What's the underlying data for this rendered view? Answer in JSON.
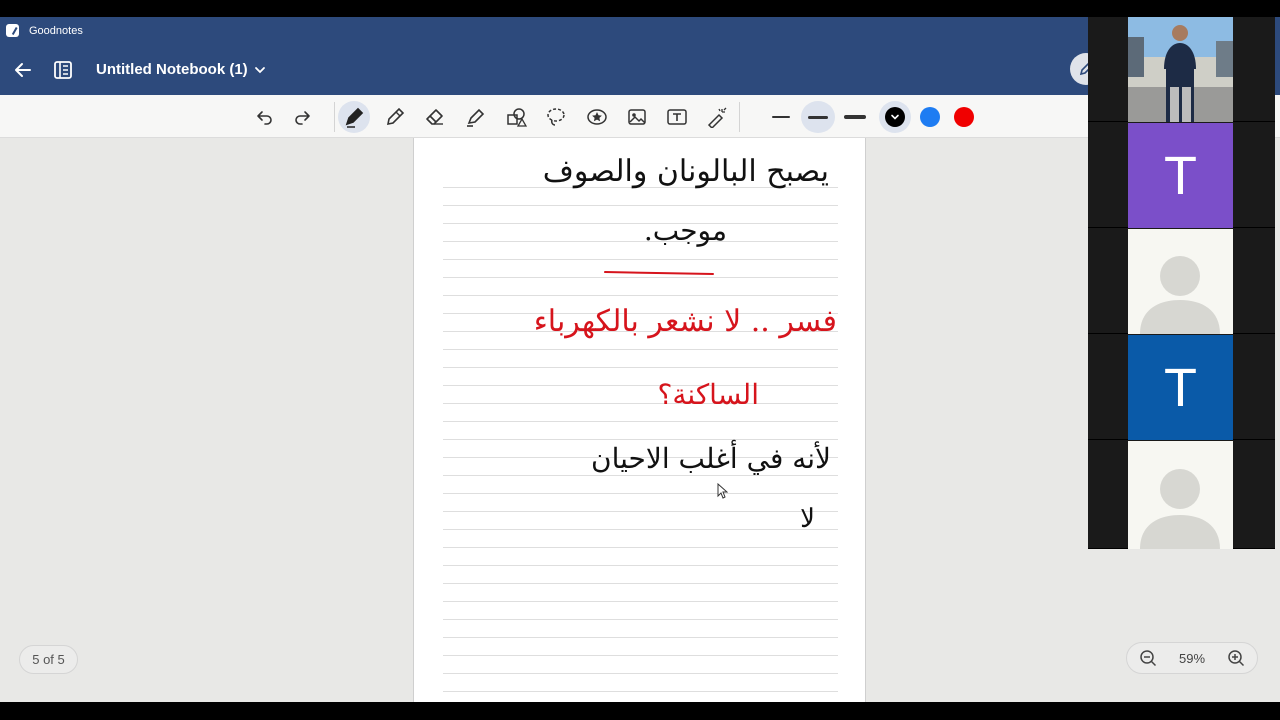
{
  "app": {
    "title": "Goodnotes",
    "icon": "goodnotes-icon"
  },
  "header": {
    "notebook_title": "Untitled Notebook (1)",
    "back_icon": "arrow-left-icon",
    "outline_icon": "outline-icon",
    "chevron_icon": "chevron-down-icon"
  },
  "toolbar": {
    "tools": [
      "undo-icon",
      "redo-icon",
      "pen-icon",
      "pencil-icon",
      "eraser-icon",
      "highlighter-icon",
      "shapes-icon",
      "lasso-icon",
      "sticker-icon",
      "image-icon",
      "text-box-icon",
      "laser-pointer-icon"
    ],
    "active_tool": "pen-icon",
    "stroke_widths": [
      "thin",
      "medium",
      "thick"
    ],
    "active_stroke": "medium",
    "colors": [
      "#000000",
      "#1e7cf2",
      "#f00000"
    ],
    "active_color": "#000000"
  },
  "page": {
    "lines": [
      {
        "text": "يصبح البالونان والصوف",
        "color": "black"
      },
      {
        "text": "موجب.",
        "color": "black"
      },
      {
        "text": "فسر .. لا نشعر بالكهرباء",
        "color": "red"
      },
      {
        "text": "الساكنة؟",
        "color": "red"
      },
      {
        "text": "لأنه في أغلب الاحيان",
        "color": "black"
      },
      {
        "text": "لا",
        "color": "black"
      }
    ]
  },
  "page_counter": "5 of 5",
  "zoom": {
    "level": "59%",
    "zoom_out_icon": "zoom-out-icon",
    "zoom_in_icon": "zoom-in-icon"
  },
  "participants": [
    {
      "type": "camera"
    },
    {
      "type": "initial",
      "initial": "T",
      "color": "#7b4fc9"
    },
    {
      "type": "avatar"
    },
    {
      "type": "initial",
      "initial": "T",
      "color": "#0a5aa8"
    },
    {
      "type": "avatar"
    }
  ]
}
